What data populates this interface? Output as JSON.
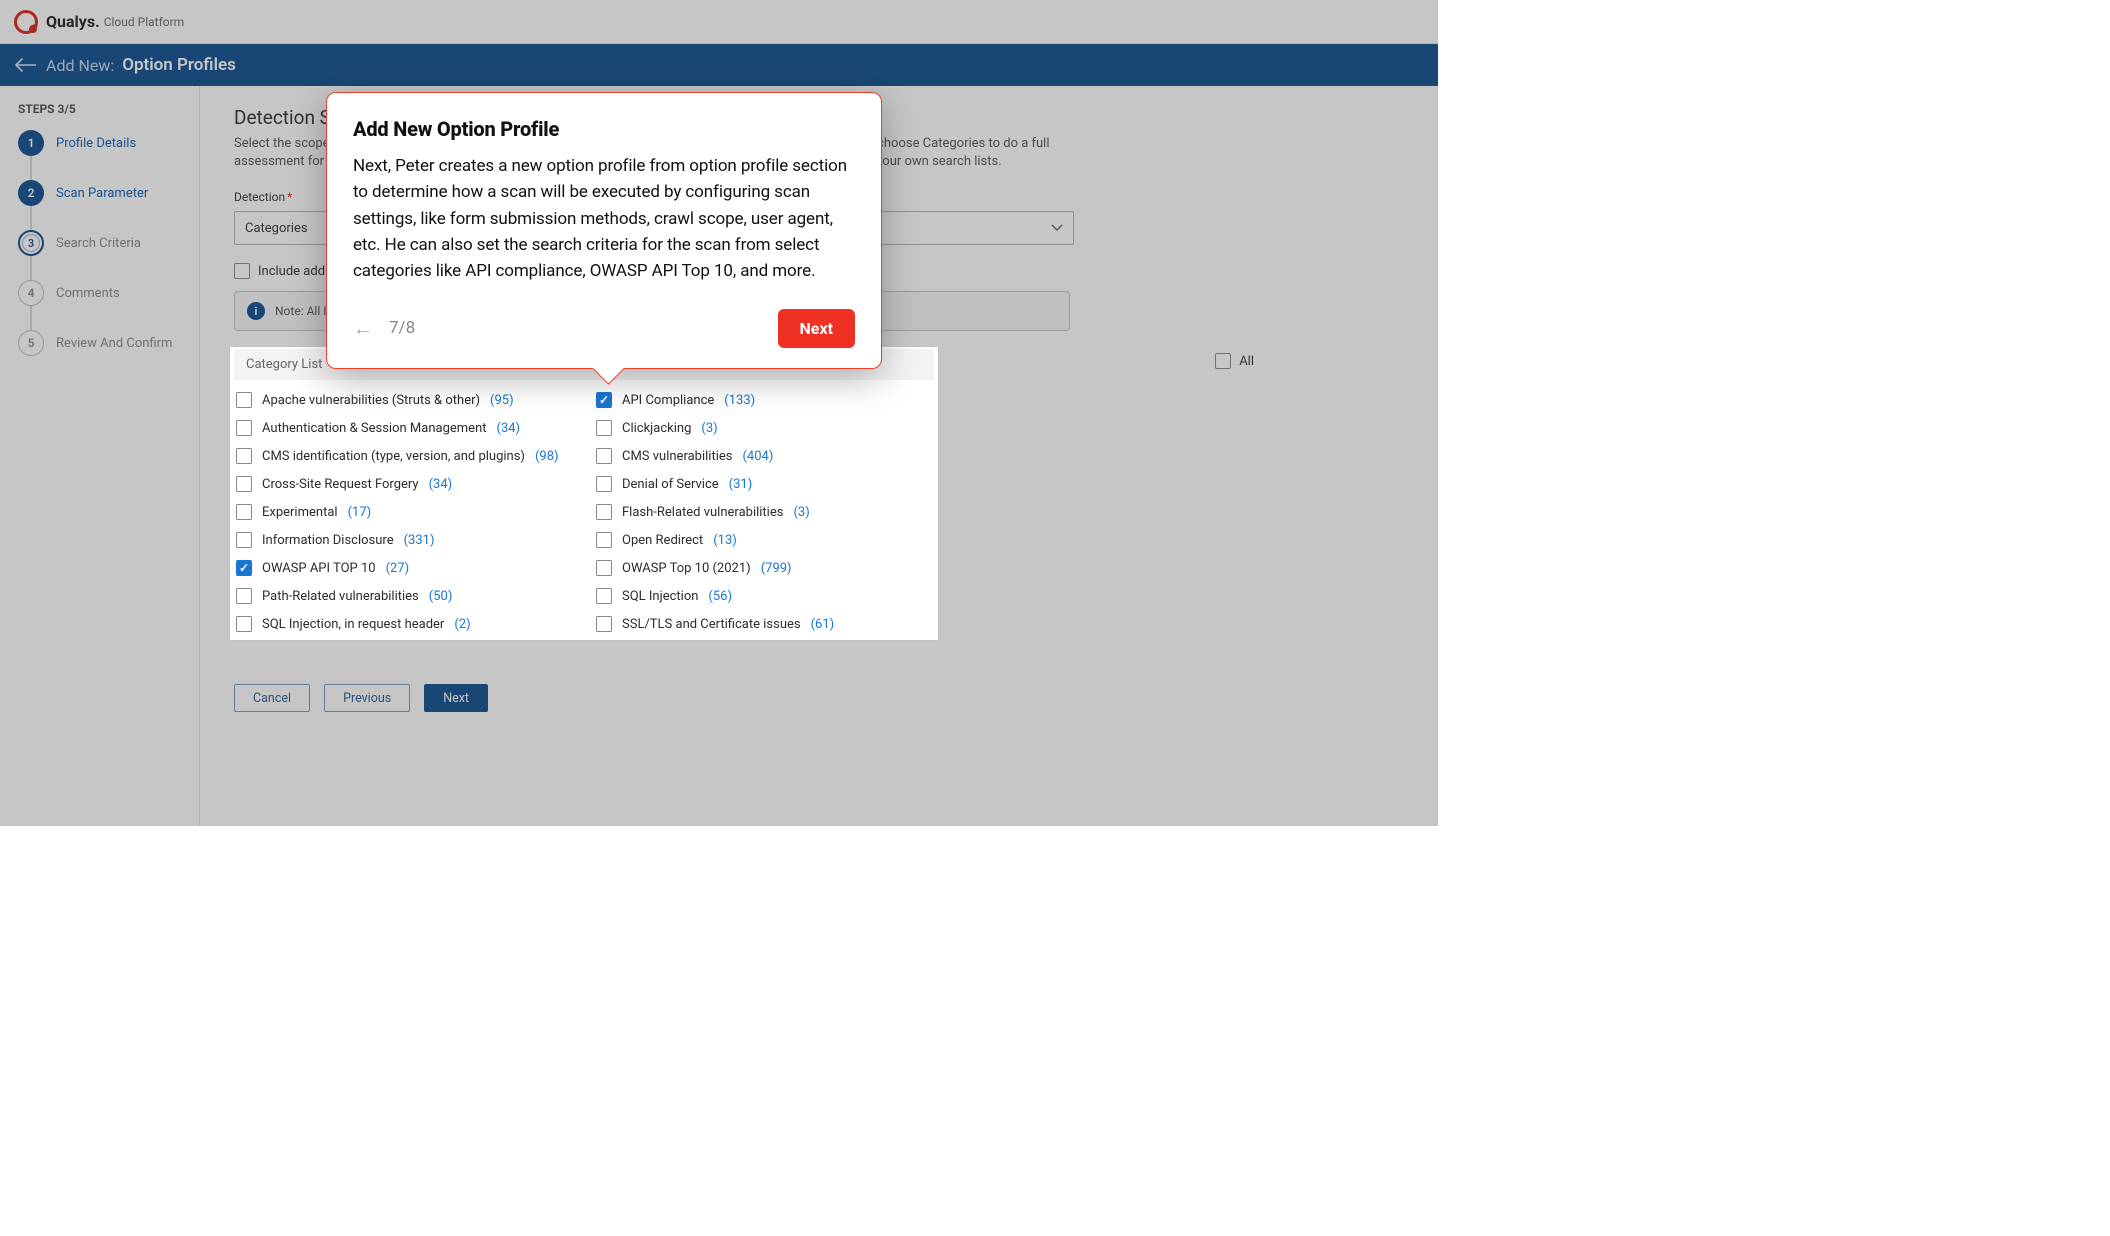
{
  "brand": {
    "name": "Qualys.",
    "sub": "Cloud Platform"
  },
  "header": {
    "addnew": "Add New:",
    "title": "Option Profiles"
  },
  "sidebar": {
    "steps_count": "STEPS 3/5",
    "steps": [
      {
        "n": "1",
        "label": "Profile Details"
      },
      {
        "n": "2",
        "label": "Scan Parameter"
      },
      {
        "n": "3",
        "label": "Search Criteria"
      },
      {
        "n": "4",
        "label": "Comments"
      },
      {
        "n": "5",
        "label": "Review And Confirm"
      }
    ]
  },
  "detection": {
    "title": "Detection Scope",
    "desc": "Select the scope for the scan. Choose Core to scan for WAS standard vulnerabilities for a baseline assessment, choose Categories to do a full assessment for all WAS detections, or if you want to scan for specific vulnerabilities, choose Custom to provide your own search lists.",
    "label": "Detection",
    "select1": "Categories",
    "select2": "",
    "include_label": "Include additional category XSS Power Mode in the scope.",
    "note": "Note: All Information Gathered (IG) checks will be included in the detection scope.",
    "cat_header": "Category List",
    "all_label": "All",
    "categories_left": [
      {
        "name": "Apache vulnerabilities (Struts & other)",
        "count": "(95)",
        "checked": false
      },
      {
        "name": "Authentication & Session Management",
        "count": "(34)",
        "checked": false
      },
      {
        "name": "CMS identification (type, version, and plugins)",
        "count": "(98)",
        "checked": false
      },
      {
        "name": "Cross-Site Request Forgery",
        "count": "(34)",
        "checked": false
      },
      {
        "name": "Experimental",
        "count": "(17)",
        "checked": false
      },
      {
        "name": "Information Disclosure",
        "count": "(331)",
        "checked": false
      },
      {
        "name": "OWASP API TOP 10",
        "count": "(27)",
        "checked": true
      },
      {
        "name": "Path-Related vulnerabilities",
        "count": "(50)",
        "checked": false
      },
      {
        "name": "SQL Injection, in request header",
        "count": "(2)",
        "checked": false
      }
    ],
    "categories_right": [
      {
        "name": "API Compliance",
        "count": "(133)",
        "checked": true
      },
      {
        "name": "Clickjacking",
        "count": "(3)",
        "checked": false
      },
      {
        "name": "CMS vulnerabilities",
        "count": "(404)",
        "checked": false
      },
      {
        "name": "Denial of Service",
        "count": "(31)",
        "checked": false
      },
      {
        "name": "Flash-Related vulnerabilities",
        "count": "(3)",
        "checked": false
      },
      {
        "name": "Open Redirect",
        "count": "(13)",
        "checked": false
      },
      {
        "name": "OWASP Top 10 (2021)",
        "count": "(799)",
        "checked": false
      },
      {
        "name": "SQL Injection",
        "count": "(56)",
        "checked": false
      },
      {
        "name": "SSL/TLS and Certificate issues",
        "count": "(61)",
        "checked": false
      }
    ]
  },
  "buttons": {
    "cancel": "Cancel",
    "previous": "Previous",
    "next": "Next"
  },
  "popup": {
    "title": "Add New Option Profile",
    "body": "Next, Peter creates a new option profile from option profile section to determine how a scan will be executed by configuring scan settings, like form submission methods, crawl scope, user agent, etc. He can also set the search criteria for the scan from select categories like API compliance, OWASP API Top 10, and more.",
    "page": "7/8",
    "next": "Next"
  }
}
